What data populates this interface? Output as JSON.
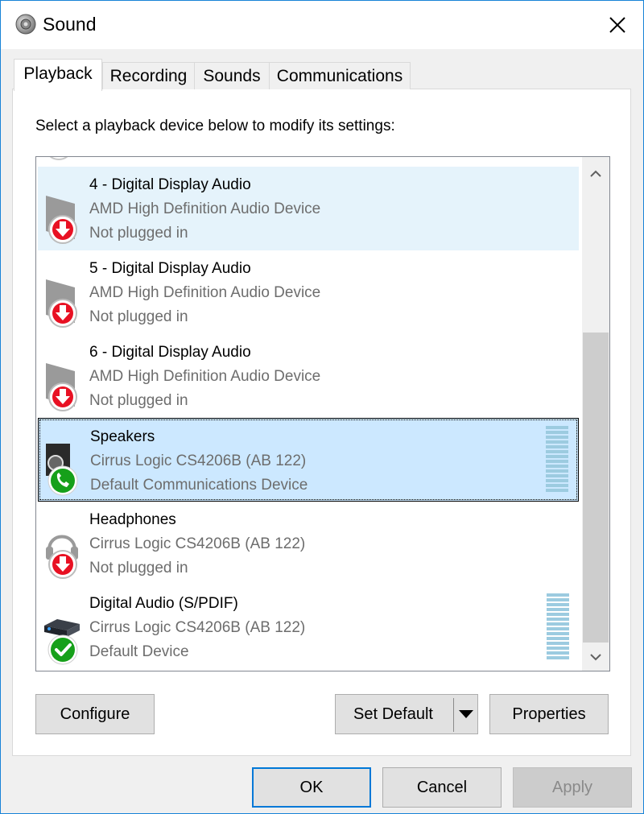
{
  "window": {
    "title": "Sound"
  },
  "tabs": [
    {
      "label": "Playback"
    },
    {
      "label": "Recording"
    },
    {
      "label": "Sounds"
    },
    {
      "label": "Communications"
    }
  ],
  "instruction": "Select a playback device below to modify its settings:",
  "devices": [
    {
      "name": "4 - Digital Display Audio",
      "line1": "AMD High Definition Audio Device",
      "line2": "Not plugged in",
      "icon": "monitor-unplugged-icon",
      "state": "hover"
    },
    {
      "name": "5 - Digital Display Audio",
      "line1": "AMD High Definition Audio Device",
      "line2": "Not plugged in",
      "icon": "monitor-unplugged-icon"
    },
    {
      "name": "6 - Digital Display Audio",
      "line1": "AMD High Definition Audio Device",
      "line2": "Not plugged in",
      "icon": "monitor-unplugged-icon"
    },
    {
      "name": "Speakers",
      "line1": "Cirrus Logic CS4206B (AB 122)",
      "line2": "Default Communications Device",
      "icon": "speaker-phone-icon",
      "state": "selected"
    },
    {
      "name": "Headphones",
      "line1": "Cirrus Logic CS4206B (AB 122)",
      "line2": "Not plugged in",
      "icon": "headphones-unplugged-icon"
    },
    {
      "name": "Digital Audio (S/PDIF)",
      "line1": "Cirrus Logic CS4206B (AB 122)",
      "line2": "Default Device",
      "icon": "digital-audio-default-icon"
    }
  ],
  "buttons": {
    "configure": "Configure",
    "set_default": "Set Default",
    "properties": "Properties",
    "ok": "OK",
    "cancel": "Cancel",
    "apply": "Apply"
  },
  "colors": {
    "accent": "#0078d7",
    "selected_bg": "#cce8ff",
    "hover_bg": "#e5f3fb",
    "red_badge": "#e81123",
    "green_badge": "#16a01a"
  }
}
